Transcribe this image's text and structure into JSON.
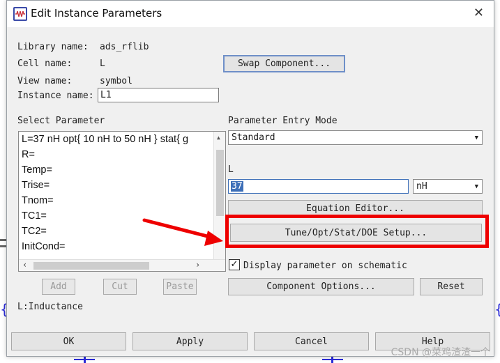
{
  "window": {
    "title": "Edit Instance Parameters",
    "close_glyph": "✕"
  },
  "info": {
    "library_label": "Library name:",
    "library_value": "ads_rflib",
    "cell_label": "Cell name:",
    "cell_value": "L",
    "view_label": "View name:",
    "view_value": "symbol",
    "instance_label": "Instance name:",
    "instance_value": "L1"
  },
  "swap_button": "Swap Component...",
  "select_parameter": {
    "label": "Select Parameter",
    "items": [
      "L=37 nH opt{ 10 nH to 50 nH } stat{ g",
      "R=",
      "Temp=",
      "Trise=",
      "Tnom=",
      "TC1=",
      "TC2=",
      "InitCond="
    ]
  },
  "list_buttons": {
    "add": "Add",
    "cut": "Cut",
    "paste": "Paste"
  },
  "description": "L:Inductance",
  "entry_mode": {
    "label": "Parameter Entry Mode",
    "value": "Standard"
  },
  "param": {
    "label": "L",
    "value": "37",
    "unit": "nH"
  },
  "equation_editor_button": "Equation Editor...",
  "tune_button": "Tune/Opt/Stat/DOE Setup...",
  "display_checkbox": {
    "label": "Display parameter on schematic",
    "checked": true,
    "glyph": "✓"
  },
  "component_options_button": "Component Options...",
  "reset_button": "Reset",
  "footer": {
    "ok": "OK",
    "apply": "Apply",
    "cancel": "Cancel",
    "help": "Help"
  },
  "watermark": "CSDN @菜鸡渣渣一个",
  "colors": {
    "annotation": "#ee0000",
    "schematic": "#2b2bd8",
    "selection": "#3d6fb8"
  }
}
